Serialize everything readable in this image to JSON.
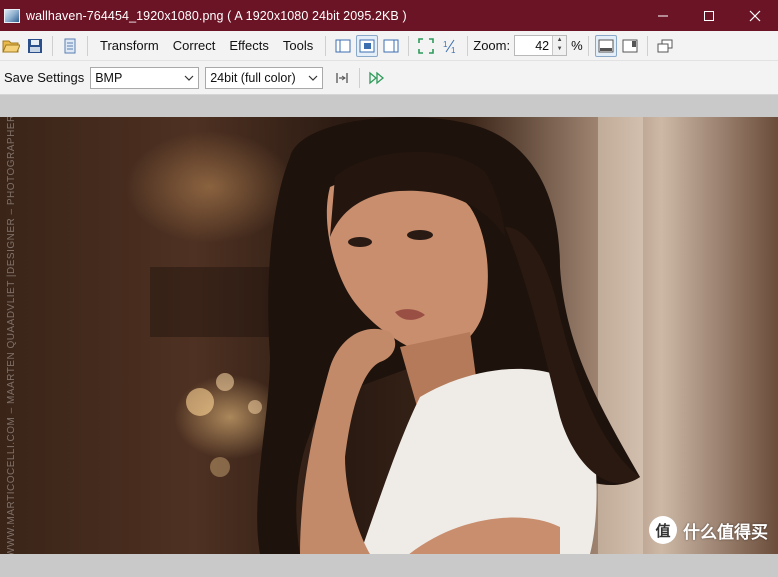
{
  "titlebar": {
    "title": "wallhaven-764454_1920x1080.png  ( A  1920x1080  24bit  2095.2KB )",
    "bg_color": "#6b1426"
  },
  "window_controls": {
    "minimize": "—",
    "maximize": "☐",
    "close": "✕"
  },
  "toolbar": {
    "menus": [
      "Transform",
      "Correct",
      "Effects",
      "Tools"
    ],
    "zoom_label": "Zoom:",
    "zoom_value": "42",
    "zoom_unit": "%"
  },
  "save_bar": {
    "label": "Save Settings",
    "format_value": "BMP",
    "depth_value": "24bit (full color)"
  },
  "image": {
    "watermark": "WWW.MARTICOCELLI.COM – MAARTEN QUAADVLIET |DESIGNER – PHOTOGRAPHER",
    "brand_text": "什么值得买",
    "brand_glyph": "值"
  }
}
